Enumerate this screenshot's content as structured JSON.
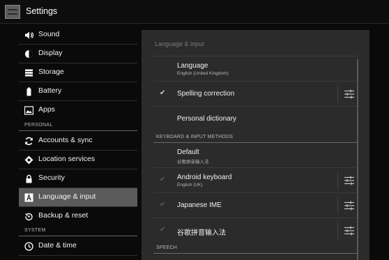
{
  "app": {
    "title": "Settings",
    "icon": "settings-app-icon"
  },
  "sidebar": {
    "items": [
      {
        "label": "Sound",
        "icon": "speaker-icon"
      },
      {
        "label": "Display",
        "icon": "brightness-icon"
      },
      {
        "label": "Storage",
        "icon": "storage-icon"
      },
      {
        "label": "Battery",
        "icon": "battery-icon"
      },
      {
        "label": "Apps",
        "icon": "apps-icon"
      },
      {
        "label": "Accounts & sync",
        "icon": "sync-icon"
      },
      {
        "label": "Location services",
        "icon": "location-icon"
      },
      {
        "label": "Security",
        "icon": "lock-icon"
      },
      {
        "label": "Language & input",
        "icon": "language-icon",
        "selected": true
      },
      {
        "label": "Backup & reset",
        "icon": "backup-icon"
      },
      {
        "label": "Date & time",
        "icon": "clock-icon"
      }
    ],
    "headers": {
      "personal": "PERSONAL",
      "system": "SYSTEM"
    }
  },
  "panel": {
    "title": "Language & input",
    "language": {
      "title": "Language",
      "summary": "English (United Kingdom)"
    },
    "spelling": {
      "title": "Spelling correction",
      "checked": true
    },
    "dictionary": {
      "title": "Personal dictionary"
    },
    "keyboard_header": "KEYBOARD & INPUT METHODS",
    "default_ime": {
      "title": "Default",
      "summary": "谷歌拼音输入法"
    },
    "android_keyboard": {
      "title": "Android keyboard",
      "summary": "English (UK)",
      "checked": true
    },
    "japanese_ime": {
      "title": "Japanese IME",
      "checked": true
    },
    "google_pinyin": {
      "title": "谷歌拼音输入法",
      "checked": true
    },
    "speech_header": "SPEECH"
  },
  "glyphs": {
    "check": "✔"
  },
  "colors": {
    "background": "#0a0a0a",
    "panel": "#2b2b2b",
    "selected": "#5a5a5a",
    "text": "#f2f2f2"
  }
}
